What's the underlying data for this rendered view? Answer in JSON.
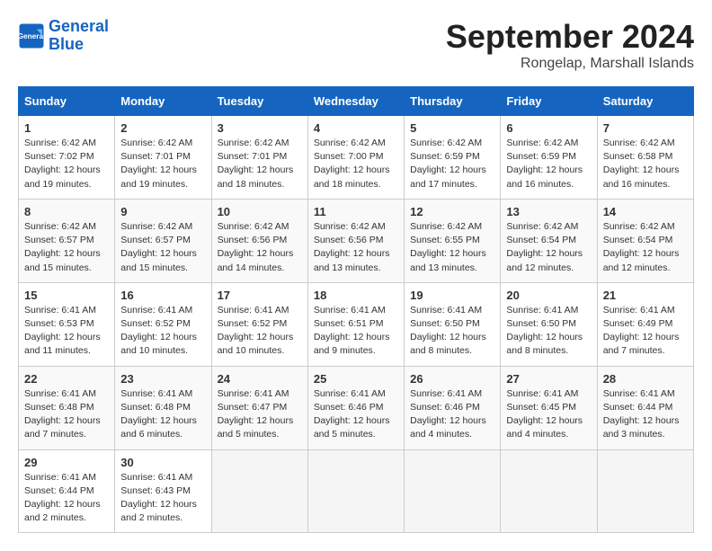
{
  "header": {
    "logo_line1": "General",
    "logo_line2": "Blue",
    "month": "September 2024",
    "location": "Rongelap, Marshall Islands"
  },
  "columns": [
    "Sunday",
    "Monday",
    "Tuesday",
    "Wednesday",
    "Thursday",
    "Friday",
    "Saturday"
  ],
  "weeks": [
    [
      {
        "day": "1",
        "info": "Sunrise: 6:42 AM\nSunset: 7:02 PM\nDaylight: 12 hours\nand 19 minutes."
      },
      {
        "day": "2",
        "info": "Sunrise: 6:42 AM\nSunset: 7:01 PM\nDaylight: 12 hours\nand 19 minutes."
      },
      {
        "day": "3",
        "info": "Sunrise: 6:42 AM\nSunset: 7:01 PM\nDaylight: 12 hours\nand 18 minutes."
      },
      {
        "day": "4",
        "info": "Sunrise: 6:42 AM\nSunset: 7:00 PM\nDaylight: 12 hours\nand 18 minutes."
      },
      {
        "day": "5",
        "info": "Sunrise: 6:42 AM\nSunset: 6:59 PM\nDaylight: 12 hours\nand 17 minutes."
      },
      {
        "day": "6",
        "info": "Sunrise: 6:42 AM\nSunset: 6:59 PM\nDaylight: 12 hours\nand 16 minutes."
      },
      {
        "day": "7",
        "info": "Sunrise: 6:42 AM\nSunset: 6:58 PM\nDaylight: 12 hours\nand 16 minutes."
      }
    ],
    [
      {
        "day": "8",
        "info": "Sunrise: 6:42 AM\nSunset: 6:57 PM\nDaylight: 12 hours\nand 15 minutes."
      },
      {
        "day": "9",
        "info": "Sunrise: 6:42 AM\nSunset: 6:57 PM\nDaylight: 12 hours\nand 15 minutes."
      },
      {
        "day": "10",
        "info": "Sunrise: 6:42 AM\nSunset: 6:56 PM\nDaylight: 12 hours\nand 14 minutes."
      },
      {
        "day": "11",
        "info": "Sunrise: 6:42 AM\nSunset: 6:56 PM\nDaylight: 12 hours\nand 13 minutes."
      },
      {
        "day": "12",
        "info": "Sunrise: 6:42 AM\nSunset: 6:55 PM\nDaylight: 12 hours\nand 13 minutes."
      },
      {
        "day": "13",
        "info": "Sunrise: 6:42 AM\nSunset: 6:54 PM\nDaylight: 12 hours\nand 12 minutes."
      },
      {
        "day": "14",
        "info": "Sunrise: 6:42 AM\nSunset: 6:54 PM\nDaylight: 12 hours\nand 12 minutes."
      }
    ],
    [
      {
        "day": "15",
        "info": "Sunrise: 6:41 AM\nSunset: 6:53 PM\nDaylight: 12 hours\nand 11 minutes."
      },
      {
        "day": "16",
        "info": "Sunrise: 6:41 AM\nSunset: 6:52 PM\nDaylight: 12 hours\nand 10 minutes."
      },
      {
        "day": "17",
        "info": "Sunrise: 6:41 AM\nSunset: 6:52 PM\nDaylight: 12 hours\nand 10 minutes."
      },
      {
        "day": "18",
        "info": "Sunrise: 6:41 AM\nSunset: 6:51 PM\nDaylight: 12 hours\nand 9 minutes."
      },
      {
        "day": "19",
        "info": "Sunrise: 6:41 AM\nSunset: 6:50 PM\nDaylight: 12 hours\nand 8 minutes."
      },
      {
        "day": "20",
        "info": "Sunrise: 6:41 AM\nSunset: 6:50 PM\nDaylight: 12 hours\nand 8 minutes."
      },
      {
        "day": "21",
        "info": "Sunrise: 6:41 AM\nSunset: 6:49 PM\nDaylight: 12 hours\nand 7 minutes."
      }
    ],
    [
      {
        "day": "22",
        "info": "Sunrise: 6:41 AM\nSunset: 6:48 PM\nDaylight: 12 hours\nand 7 minutes."
      },
      {
        "day": "23",
        "info": "Sunrise: 6:41 AM\nSunset: 6:48 PM\nDaylight: 12 hours\nand 6 minutes."
      },
      {
        "day": "24",
        "info": "Sunrise: 6:41 AM\nSunset: 6:47 PM\nDaylight: 12 hours\nand 5 minutes."
      },
      {
        "day": "25",
        "info": "Sunrise: 6:41 AM\nSunset: 6:46 PM\nDaylight: 12 hours\nand 5 minutes."
      },
      {
        "day": "26",
        "info": "Sunrise: 6:41 AM\nSunset: 6:46 PM\nDaylight: 12 hours\nand 4 minutes."
      },
      {
        "day": "27",
        "info": "Sunrise: 6:41 AM\nSunset: 6:45 PM\nDaylight: 12 hours\nand 4 minutes."
      },
      {
        "day": "28",
        "info": "Sunrise: 6:41 AM\nSunset: 6:44 PM\nDaylight: 12 hours\nand 3 minutes."
      }
    ],
    [
      {
        "day": "29",
        "info": "Sunrise: 6:41 AM\nSunset: 6:44 PM\nDaylight: 12 hours\nand 2 minutes."
      },
      {
        "day": "30",
        "info": "Sunrise: 6:41 AM\nSunset: 6:43 PM\nDaylight: 12 hours\nand 2 minutes."
      },
      {
        "day": "",
        "info": ""
      },
      {
        "day": "",
        "info": ""
      },
      {
        "day": "",
        "info": ""
      },
      {
        "day": "",
        "info": ""
      },
      {
        "day": "",
        "info": ""
      }
    ]
  ]
}
